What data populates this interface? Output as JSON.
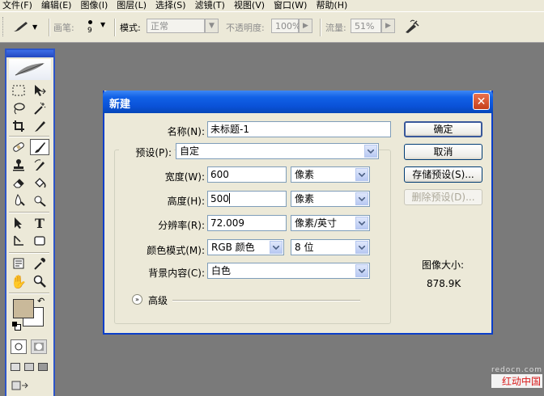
{
  "menubar": {
    "items": [
      "文件(F)",
      "编辑(E)",
      "图像(I)",
      "图层(L)",
      "选择(S)",
      "滤镜(T)",
      "视图(V)",
      "窗口(W)",
      "帮助(H)"
    ]
  },
  "options_bar": {
    "brush_label": "画笔:",
    "brush_size": "9",
    "mode_label": "模式:",
    "mode_value": "正常",
    "opacity_label": "不透明度:",
    "opacity_value": "100%",
    "flow_label": "流量:",
    "flow_value": "51%"
  },
  "dialog": {
    "title": "新建",
    "close_glyph": "✕",
    "name_label": "名称(N):",
    "name_value": "未标题-1",
    "preset_label": "预设(P):",
    "preset_value": "自定",
    "width_label": "宽度(W):",
    "width_value": "600",
    "width_unit": "像素",
    "height_label": "高度(H):",
    "height_value": "500",
    "height_unit": "像素",
    "resolution_label": "分辨率(R):",
    "resolution_value": "72.009",
    "resolution_unit": "像素/英寸",
    "color_mode_label": "颜色模式(M):",
    "color_mode_value": "RGB 颜色",
    "bit_depth_value": "8 位",
    "background_label": "背景内容(C):",
    "background_value": "白色",
    "advanced_label": "高级",
    "image_size_label": "图像大小:",
    "image_size_value": "878.9K",
    "buttons": {
      "ok": "确定",
      "cancel": "取消",
      "save_preset": "存储预设(S)...",
      "delete_preset": "删除预设(D)..."
    }
  },
  "watermark": {
    "url": "redocn.com",
    "name": "红动中国"
  },
  "colors": {
    "foreground": "#c9b99a",
    "background": "#ffffff",
    "title_bar": "#0a52d8",
    "workspace": "#7a7a7a"
  }
}
